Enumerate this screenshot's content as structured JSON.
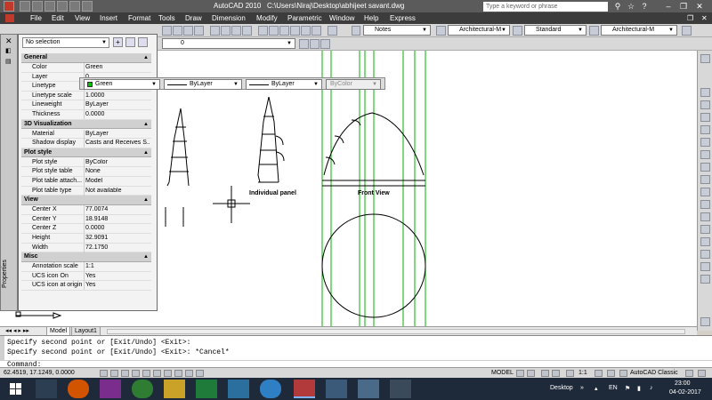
{
  "title": {
    "app": "AutoCAD 2010",
    "path": "C:\\Users\\Niraj\\Desktop\\abhijeet savant.dwg",
    "search_placeholder": "Type a keyword or phrase"
  },
  "menu": [
    "File",
    "Edit",
    "View",
    "Insert",
    "Format",
    "Tools",
    "Draw",
    "Dimension",
    "Modify",
    "Parametric",
    "Window",
    "Help",
    "Express"
  ],
  "toolbar2": {
    "layer_value": "0",
    "text_style": "Notes",
    "dim_style": "Architectural-M",
    "table_style": "Standard",
    "multileader_style": "Architectural-M"
  },
  "properties": {
    "selection": "No selection",
    "side_label": "Properties",
    "sections": [
      {
        "name": "General",
        "rows": [
          {
            "key": "Color",
            "value": "Green"
          },
          {
            "key": "Layer",
            "value": "0"
          },
          {
            "key": "Linetype",
            "value": "ByLayer"
          },
          {
            "key": "Linetype scale",
            "value": "1.0000"
          },
          {
            "key": "Lineweight",
            "value": "ByLayer"
          },
          {
            "key": "Thickness",
            "value": "0.0000"
          }
        ]
      },
      {
        "name": "3D Visualization",
        "rows": [
          {
            "key": "Material",
            "value": "ByLayer"
          },
          {
            "key": "Shadow display",
            "value": "Casts and Receives S..."
          }
        ]
      },
      {
        "name": "Plot style",
        "rows": [
          {
            "key": "Plot style",
            "value": "ByColor"
          },
          {
            "key": "Plot style table",
            "value": "None"
          },
          {
            "key": "Plot table attach...",
            "value": "Model"
          },
          {
            "key": "Plot table type",
            "value": "Not available"
          }
        ]
      },
      {
        "name": "View",
        "rows": [
          {
            "key": "Center X",
            "value": "77.0074"
          },
          {
            "key": "Center Y",
            "value": "18.9148"
          },
          {
            "key": "Center Z",
            "value": "0.0000"
          },
          {
            "key": "Height",
            "value": "32.9091"
          },
          {
            "key": "Width",
            "value": "72.1750"
          }
        ]
      },
      {
        "name": "Misc",
        "rows": [
          {
            "key": "Annotation scale",
            "value": "1:1"
          },
          {
            "key": "UCS icon On",
            "value": "Yes"
          },
          {
            "key": "UCS icon at origin",
            "value": "Yes"
          }
        ]
      }
    ]
  },
  "layer_toolbar": {
    "color": "Green",
    "linetype": "ByLayer",
    "lineweight": "ByLayer",
    "plotstyle": "ByColor"
  },
  "drawing": {
    "label_panel": "Individual panel",
    "label_front": "Front View"
  },
  "tabs": [
    "Model",
    "Layout1"
  ],
  "command": {
    "line1": "Specify second point or [Exit/Undo] <Exit>:",
    "line2": "Specify second point or [Exit/Undo] <Exit>: *Cancel*",
    "prompt": "Command:"
  },
  "status": {
    "coords": "62.4519, 17.1249, 0.0000",
    "model": "MODEL",
    "scale": "1:1",
    "workspace": "AutoCAD Classic"
  },
  "taskbar": {
    "desktop": "Desktop",
    "lang": "EN",
    "time": "23:00",
    "date": "04-02-2017"
  },
  "colors": {
    "green": "#00c000",
    "titlebar": "#5b5b5b",
    "taskbar": "#1e2a3a"
  }
}
